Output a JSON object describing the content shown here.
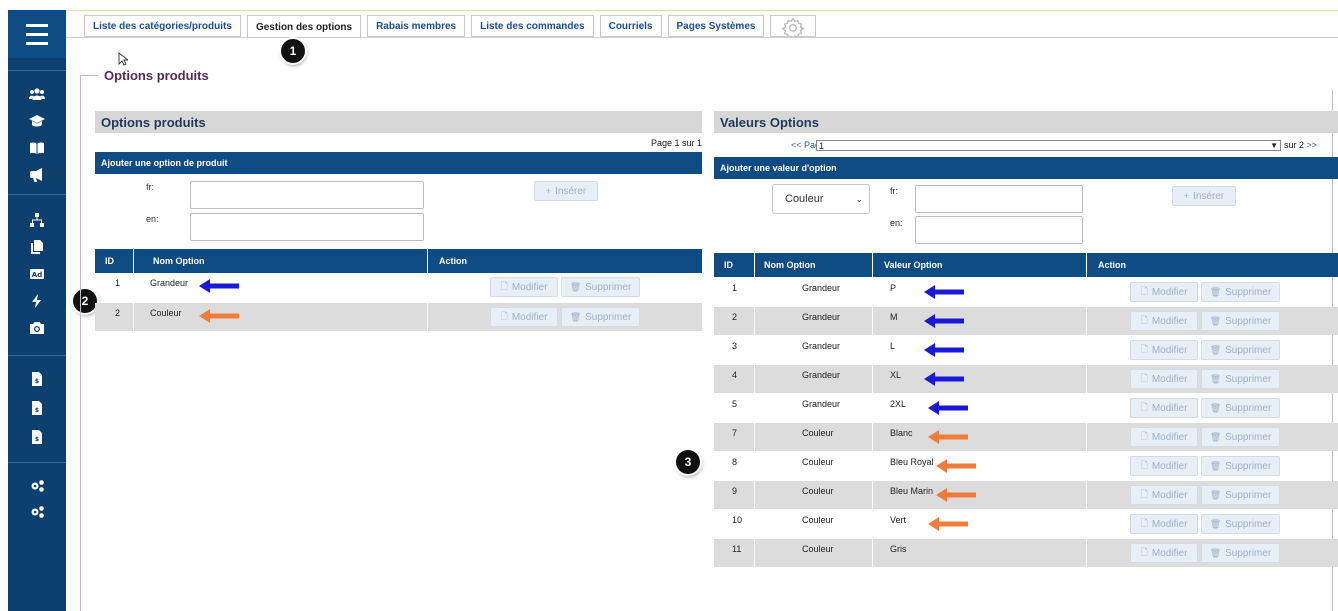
{
  "tabs": [
    {
      "label": "Liste des catégories/produits"
    },
    {
      "label": "Gestion des options"
    },
    {
      "label": "Rabais membres"
    },
    {
      "label": "Liste des commandes"
    },
    {
      "label": "Courriels"
    },
    {
      "label": "Pages Systèmes"
    }
  ],
  "legend": "Options produits",
  "badges": [
    "1",
    "2",
    "3"
  ],
  "left": {
    "title": "Options produits",
    "page_info": "Page 1 sur 1",
    "add_bar": "Ajouter une option de produit",
    "label_fr": "fr:",
    "label_en": "en:",
    "insert_label": "Insérer",
    "headers": [
      "ID",
      "Nom Option",
      "Action"
    ],
    "rows": [
      {
        "id": "1",
        "name": "Grandeur",
        "arrow": "blue"
      },
      {
        "id": "2",
        "name": "Couleur",
        "arrow": "orange"
      }
    ]
  },
  "right": {
    "title": "Valeurs Options",
    "pager_prev": "<< Page",
    "page_value": "1",
    "pager_total": "sur 2",
    "pager_next": ">>",
    "add_bar": "Ajouter une valeur d'option",
    "select_value": "Couleur",
    "label_fr": "fr:",
    "label_en": "en:",
    "insert_label": "Insérer",
    "headers": [
      "ID",
      "Nom Option",
      "Valeur Option",
      "Action"
    ],
    "rows": [
      {
        "id": "1",
        "name": "Grandeur",
        "value": "P",
        "arrow": "blue"
      },
      {
        "id": "2",
        "name": "Grandeur",
        "value": "M",
        "arrow": "blue"
      },
      {
        "id": "3",
        "name": "Grandeur",
        "value": "L",
        "arrow": "blue"
      },
      {
        "id": "4",
        "name": "Grandeur",
        "value": "XL",
        "arrow": "blue"
      },
      {
        "id": "5",
        "name": "Grandeur",
        "value": "2XL",
        "arrow": "blue"
      },
      {
        "id": "7",
        "name": "Couleur",
        "value": "Blanc",
        "arrow": "orange"
      },
      {
        "id": "8",
        "name": "Couleur",
        "value": "Bleu Royal",
        "arrow": "orange"
      },
      {
        "id": "9",
        "name": "Couleur",
        "value": "Bleu Marin",
        "arrow": "orange"
      },
      {
        "id": "10",
        "name": "Couleur",
        "value": "Vert",
        "arrow": "orange"
      },
      {
        "id": "11",
        "name": "Couleur",
        "value": "Gris",
        "arrow": ""
      }
    ]
  },
  "buttons": {
    "edit": "Modifier",
    "delete": "Supprimer"
  },
  "colors": {
    "brand": "#0f4c84",
    "arrow_blue": "#1a1ad6",
    "arrow_orange": "#f07c3a"
  },
  "sidebar_icons": [
    "users-icon",
    "graduation-cap-icon",
    "book-icon",
    "megaphone-icon",
    "sitemap-icon",
    "copy-icon",
    "ad-icon",
    "bolt-icon",
    "camera-icon",
    "invoice-icon",
    "invoice-icon",
    "invoice-icon",
    "cogs-icon",
    "cogs-icon"
  ]
}
